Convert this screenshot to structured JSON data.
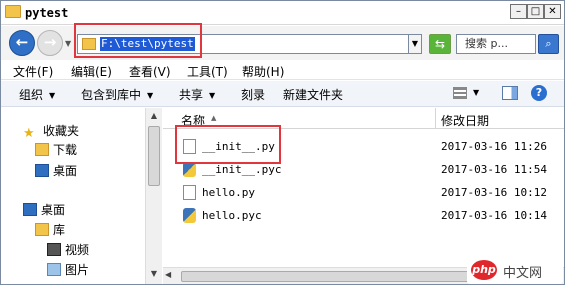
{
  "window": {
    "title": "pytest"
  },
  "caption_buttons": {
    "minimize": "–",
    "maximize": "□",
    "close": "✕"
  },
  "address": {
    "path": "F:\\test\\pytest"
  },
  "search": {
    "placeholder": "搜索 p..."
  },
  "menu": [
    "文件(F)",
    "编辑(E)",
    "查看(V)",
    "工具(T)",
    "帮助(H)"
  ],
  "toolbar": {
    "organize": "组织",
    "include_library": "包含到库中",
    "share": "共享",
    "burn": "刻录",
    "new_folder": "新建文件夹"
  },
  "nav": {
    "favorites": "收藏夹",
    "downloads": "下载",
    "desktop_fav": "桌面",
    "desktop": "桌面",
    "libraries": "库",
    "videos": "视频",
    "pictures": "图片"
  },
  "columns": {
    "name": "名称",
    "modified": "修改日期"
  },
  "files": [
    {
      "name": "__init__.py",
      "date": "2017-03-16 11:26",
      "icon": "py-file-icon"
    },
    {
      "name": "__init__.pyc",
      "date": "2017-03-16 11:54",
      "icon": "pyc-file-icon"
    },
    {
      "name": "hello.py",
      "date": "2017-03-16 10:12",
      "icon": "py-file-icon"
    },
    {
      "name": "hello.pyc",
      "date": "2017-03-16 10:14",
      "icon": "pyc-file-icon"
    }
  ],
  "watermark": {
    "logo": "php",
    "text": "中文网"
  },
  "colors": {
    "highlight_box": "#e0363d",
    "selection": "#1e5ad6",
    "toolbar_bg": "#f1f4f9"
  }
}
